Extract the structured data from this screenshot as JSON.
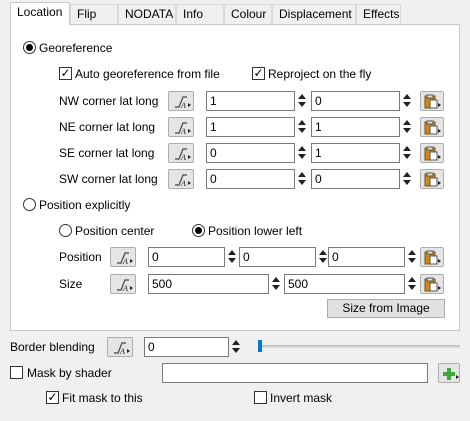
{
  "tabs": [
    "Location",
    "Flip",
    "NODATA",
    "Info",
    "Colour",
    "Displacement",
    "Effects"
  ],
  "georeference": {
    "label": "Georeference",
    "auto_label": "Auto georeference from file",
    "reproject_label": "Reproject on the fly",
    "corners": [
      {
        "label": "NW corner lat long",
        "a": "1",
        "b": "0"
      },
      {
        "label": "NE corner lat long",
        "a": "1",
        "b": "1"
      },
      {
        "label": "SE corner lat long",
        "a": "0",
        "b": "1"
      },
      {
        "label": "SW corner lat long",
        "a": "0",
        "b": "0"
      }
    ]
  },
  "explicit": {
    "label": "Position explicitly",
    "center_label": "Position center",
    "lower_left_label": "Position lower left",
    "position_label": "Position",
    "position": [
      "0",
      "0",
      "0"
    ],
    "size_label": "Size",
    "size": [
      "500",
      "500"
    ],
    "size_from_image_label": "Size from Image"
  },
  "border_blending": {
    "label": "Border blending",
    "value": "0",
    "slider_fraction": 0.0
  },
  "mask": {
    "label": "Mask by shader",
    "value": "",
    "fit_label": "Fit mask to this",
    "invert_label": "Invert mask"
  },
  "icons": {
    "fx": "function-editor-icon",
    "paste": "paste-clipboard-icon",
    "add": "add-green-plus-icon"
  },
  "colors": {
    "accent": "#0078d7",
    "plus": "#3aa83a"
  }
}
